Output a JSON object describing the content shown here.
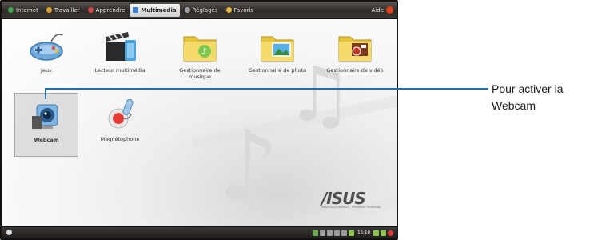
{
  "topbar": {
    "tabs": [
      {
        "label": "Internet",
        "icon": "globe-icon",
        "color": "#3fa34d"
      },
      {
        "label": "Travailler",
        "icon": "briefcase-icon",
        "color": "#e0a030"
      },
      {
        "label": "Apprendre",
        "icon": "book-icon",
        "color": "#d24a4a"
      },
      {
        "label": "Multimédia",
        "icon": "film-icon",
        "color": "#3a7fd0",
        "active": true
      },
      {
        "label": "Réglages",
        "icon": "gear-icon",
        "color": "#9aa0a6"
      },
      {
        "label": "Favoris",
        "icon": "star-icon",
        "color": "#e8b63a"
      }
    ],
    "help_label": "Aide"
  },
  "apps": [
    {
      "label": "Jeux",
      "icon": "gamepad-icon"
    },
    {
      "label": "Lecteur multimédia",
      "icon": "clapperboard-icon"
    },
    {
      "label": "Gestionnaire de musique",
      "icon": "music-folder-icon"
    },
    {
      "label": "Gestionnaire de photo",
      "icon": "photo-folder-icon"
    },
    {
      "label": "Gestionnaire de vidéo",
      "icon": "video-folder-icon"
    },
    {
      "label": "Webcam",
      "icon": "webcam-icon",
      "selected": true
    },
    {
      "label": "Magnétophone",
      "icon": "microphone-icon"
    }
  ],
  "brand": {
    "logo_text": "/ISUS",
    "tagline": "Inspiring Innovation · Persistent Perfection"
  },
  "taskbar": {
    "clock": "15:10"
  },
  "callout": {
    "text": "Pour activer la Webcam"
  },
  "colors": {
    "accent": "#1f6fae",
    "bar": "#2f2c29"
  }
}
